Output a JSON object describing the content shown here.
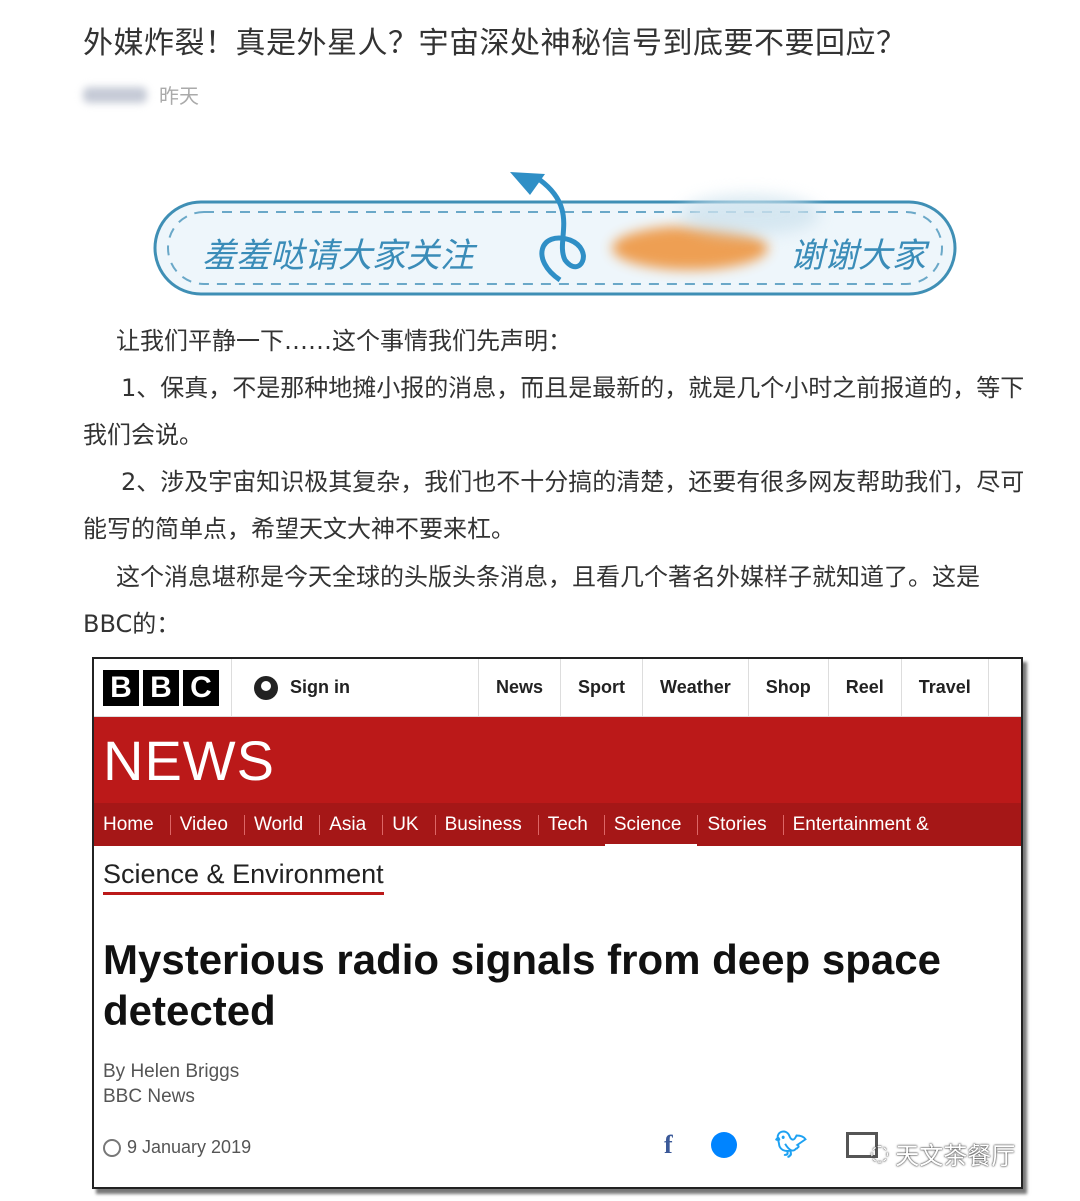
{
  "article": {
    "title": "外媒炸裂！真是外星人？宇宙深处神秘信号到底要不要回应？",
    "time": "昨天"
  },
  "banner": {
    "text": "羞羞哒请大家关注",
    "text2": "谢谢大家"
  },
  "paragraphs": [
    "让我们平静一下……这个事情我们先声明：",
    "1、保真，不是那种地摊小报的消息，而且是最新的，就是几个小时之前报道的，等下我们会说。",
    "2、涉及宇宙知识极其复杂，我们也不十分搞的清楚，还要有很多网友帮助我们，尽可能写的简单点，希望天文大神不要来杠。",
    "这个消息堪称是今天全球的头版头条消息，且看几个著名外媒样子就知道了。这是BBC的："
  ],
  "bbc": {
    "logo": [
      "B",
      "B",
      "C"
    ],
    "signin": "Sign in",
    "top_nav": [
      "News",
      "Sport",
      "Weather",
      "Shop",
      "Reel",
      "Travel"
    ],
    "brand": "NEWS",
    "sub_nav": [
      "Home",
      "Video",
      "World",
      "Asia",
      "UK",
      "Business",
      "Tech",
      "Science",
      "Stories",
      "Entertainment &"
    ],
    "active_sub": "Science",
    "section": "Science & Environment",
    "headline": "Mysterious radio signals from deep space detected",
    "byline": "By Helen Briggs",
    "outlet": "BBC News",
    "date": "9 January 2019",
    "colors": {
      "red": "#bb1919",
      "nav_red": "#a51717"
    }
  },
  "watermark": "天文茶餐厅"
}
